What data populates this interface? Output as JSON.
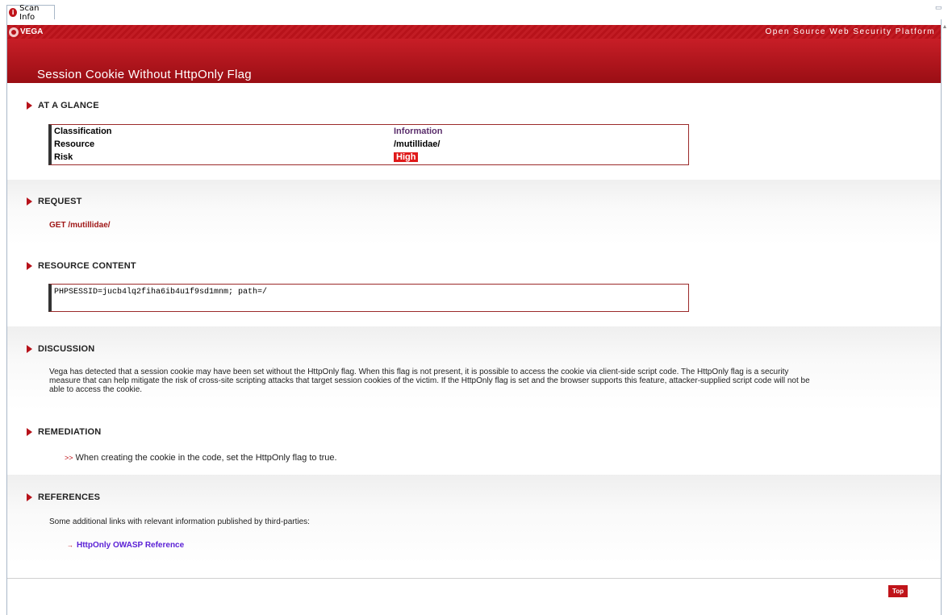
{
  "tab": {
    "title": "Scan Info",
    "icon": "info-icon"
  },
  "header": {
    "logo_text": "VEGA",
    "tagline": "Open Source Web Security Platform",
    "page_title": "Session Cookie Without HttpOnly Flag"
  },
  "at_a_glance": {
    "heading": "AT A GLANCE",
    "rows": [
      {
        "label": "Classification",
        "value": "Information"
      },
      {
        "label": "Resource",
        "value": "/mutillidae/"
      },
      {
        "label": "Risk",
        "value": "High"
      }
    ]
  },
  "request": {
    "heading": "REQUEST",
    "text": "GET /mutillidae/"
  },
  "resource_content": {
    "heading": "RESOURCE CONTENT",
    "text": "PHPSESSID=jucb4lq2fiha6ib4u1f9sd1mnm; path=/"
  },
  "discussion": {
    "heading": "DISCUSSION",
    "text": "Vega has detected that a session cookie may have been set without the HttpOnly flag. When this flag is not present, it is possible to access the cookie via client-side script code. The HttpOnly flag is a security measure that can help mitigate the risk of cross-site scripting attacks that target session cookies of the victim. If the HttpOnly flag is set and the browser supports this feature, attacker-supplied script code will not be able to access the cookie."
  },
  "remediation": {
    "heading": "REMEDIATION",
    "item": "When creating the cookie in the code, set the HttpOnly flag to true."
  },
  "references": {
    "heading": "REFERENCES",
    "intro": "Some additional links with relevant information published by third-parties:",
    "link": "HttpOnly OWASP Reference"
  },
  "footer": {
    "top_label": "Top"
  },
  "colors": {
    "brand_red": "#c0141a",
    "risk_high": "#e01a1a",
    "link_purple": "#5b21d6"
  }
}
